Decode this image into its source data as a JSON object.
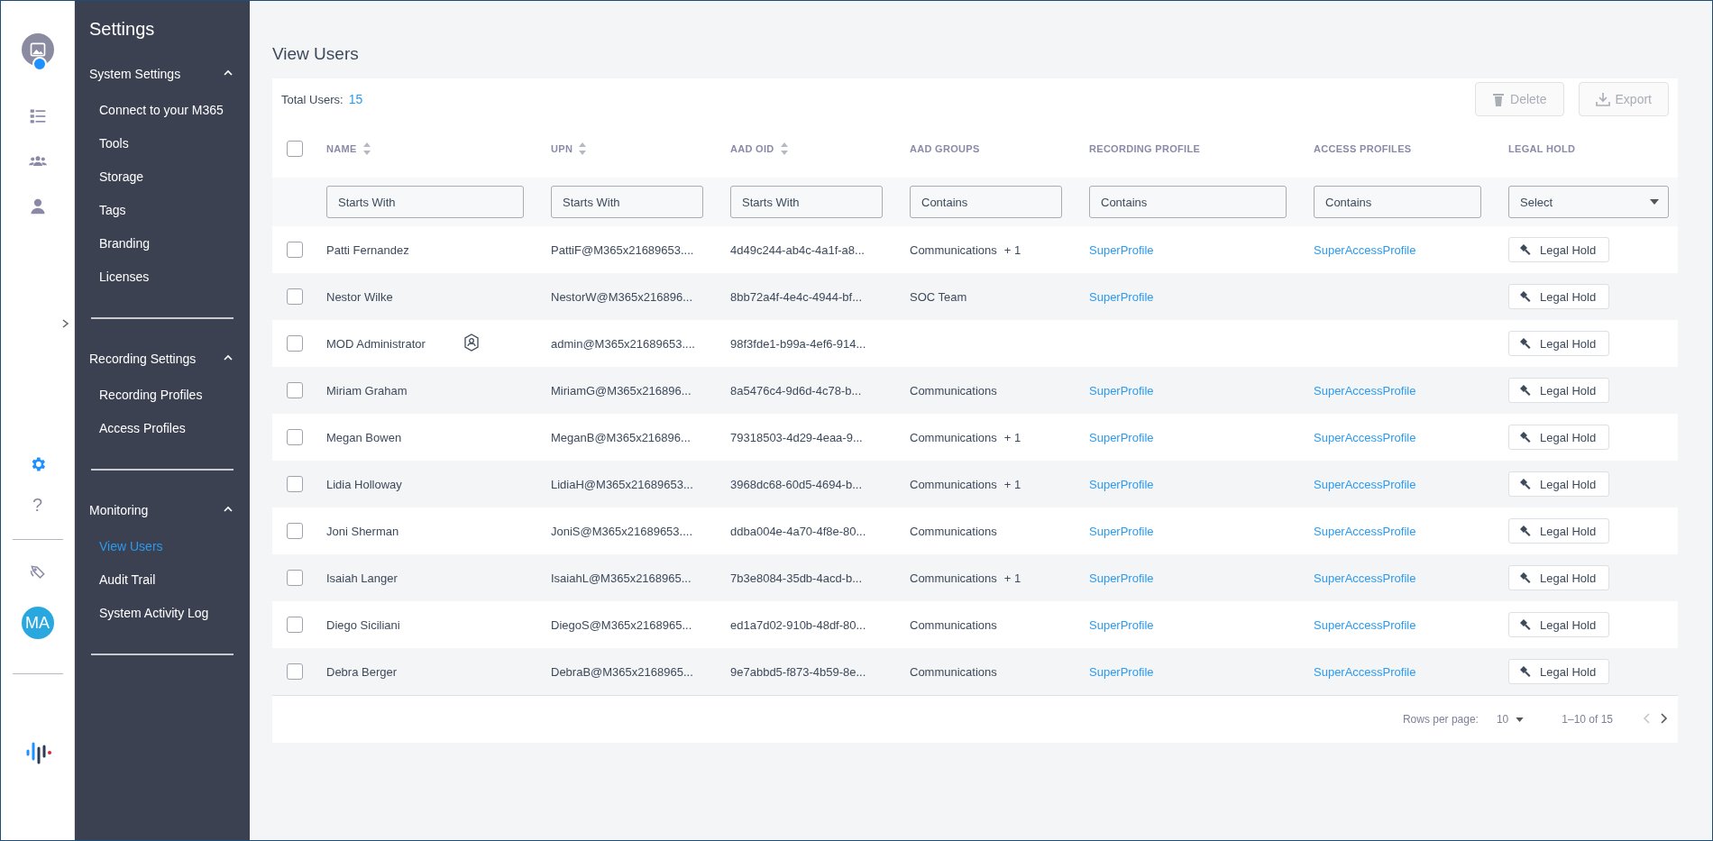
{
  "rail": {
    "help_glyph": "?",
    "user_initials": "MA",
    "settings_selected": true
  },
  "sidebar": {
    "title": "Settings",
    "sections": [
      {
        "title": "System Settings",
        "expanded": true,
        "items": [
          {
            "label": "Connect to your M365",
            "selected": false
          },
          {
            "label": "Tools",
            "selected": false
          },
          {
            "label": "Storage",
            "selected": false
          },
          {
            "label": "Tags",
            "selected": false
          },
          {
            "label": "Branding",
            "selected": false
          },
          {
            "label": "Licenses",
            "selected": false
          }
        ]
      },
      {
        "title": "Recording Settings",
        "expanded": true,
        "items": [
          {
            "label": "Recording Profiles",
            "selected": false
          },
          {
            "label": "Access Profiles",
            "selected": false
          }
        ]
      },
      {
        "title": "Monitoring",
        "expanded": true,
        "items": [
          {
            "label": "View Users",
            "selected": true
          },
          {
            "label": "Audit Trail",
            "selected": false
          },
          {
            "label": "System Activity Log",
            "selected": false
          }
        ]
      }
    ]
  },
  "page": {
    "title": "View Users"
  },
  "summary": {
    "label": "Total Users:",
    "count": "15"
  },
  "actions": [
    {
      "kind": "delete",
      "label": "Delete",
      "disabled": true
    },
    {
      "kind": "export",
      "label": "Export",
      "disabled": true
    }
  ],
  "table": {
    "all_checked": false,
    "columns": [
      {
        "label": "NAME",
        "sortable": true,
        "filter": "Starts With"
      },
      {
        "label": "UPN",
        "sortable": true,
        "filter": "Starts With"
      },
      {
        "label": "AAD OID",
        "sortable": true,
        "filter": "Starts With"
      },
      {
        "label": "AAD GROUPS",
        "sortable": false,
        "filter": "Contains"
      },
      {
        "label": "RECORDING PROFILE",
        "sortable": false,
        "filter": "Contains"
      },
      {
        "label": "ACCESS PROFILES",
        "sortable": false,
        "filter": "Contains"
      },
      {
        "label": "LEGAL HOLD",
        "sortable": false,
        "filter": "Select",
        "kind": "select"
      }
    ],
    "rows": [
      {
        "checked": false,
        "name": "Patti Fernandez",
        "admin": false,
        "upn": "PattiF@M365x21689653....",
        "oid": "4d49c244-ab4c-4a1f-a8...",
        "groups": "Communications",
        "groups_more": "+ 1",
        "recording_profile": "SuperProfile",
        "access_profile": "SuperAccessProfile",
        "action": "Legal Hold"
      },
      {
        "checked": false,
        "name": "Nestor Wilke",
        "admin": false,
        "upn": "NestorW@M365x216896...",
        "oid": "8bb72a4f-4e4c-4944-bf...",
        "groups": "SOC Team",
        "recording_profile": "SuperProfile",
        "action": "Legal Hold"
      },
      {
        "checked": false,
        "name": "MOD Administrator",
        "admin": true,
        "upn": "admin@M365x21689653....",
        "oid": "98f3fde1-b99a-4ef6-914...",
        "action": "Legal Hold"
      },
      {
        "checked": false,
        "name": "Miriam Graham",
        "admin": false,
        "upn": "MiriamG@M365x216896...",
        "oid": "8a5476c4-9d6d-4c78-b...",
        "groups": "Communications",
        "recording_profile": "SuperProfile",
        "access_profile": "SuperAccessProfile",
        "action": "Legal Hold"
      },
      {
        "checked": false,
        "name": "Megan Bowen",
        "admin": false,
        "upn": "MeganB@M365x216896...",
        "oid": "79318503-4d29-4eaa-9...",
        "groups": "Communications",
        "groups_more": "+ 1",
        "recording_profile": "SuperProfile",
        "access_profile": "SuperAccessProfile",
        "action": "Legal Hold"
      },
      {
        "checked": false,
        "name": "Lidia Holloway",
        "admin": false,
        "upn": "LidiaH@M365x21689653...",
        "oid": "3968dc68-60d5-4694-b...",
        "groups": "Communications",
        "groups_more": "+ 1",
        "recording_profile": "SuperProfile",
        "access_profile": "SuperAccessProfile",
        "action": "Legal Hold"
      },
      {
        "checked": false,
        "name": "Joni Sherman",
        "admin": false,
        "upn": "JoniS@M365x21689653....",
        "oid": "ddba004e-4a70-4f8e-80...",
        "groups": "Communications",
        "recording_profile": "SuperProfile",
        "access_profile": "SuperAccessProfile",
        "action": "Legal Hold"
      },
      {
        "checked": false,
        "name": "Isaiah Langer",
        "admin": false,
        "upn": "IsaiahL@M365x2168965...",
        "oid": "7b3e8084-35db-4acd-b...",
        "groups": "Communications",
        "groups_more": "+ 1",
        "recording_profile": "SuperProfile",
        "access_profile": "SuperAccessProfile",
        "action": "Legal Hold"
      },
      {
        "checked": false,
        "name": "Diego Siciliani",
        "admin": false,
        "upn": "DiegoS@M365x2168965...",
        "oid": "ed1a7d02-910b-48df-80...",
        "groups": "Communications",
        "recording_profile": "SuperProfile",
        "access_profile": "SuperAccessProfile",
        "action": "Legal Hold"
      },
      {
        "checked": false,
        "name": "Debra Berger",
        "admin": false,
        "upn": "DebraB@M365x2168965...",
        "oid": "9e7abbd5-f873-4b59-8e...",
        "groups": "Communications",
        "recording_profile": "SuperProfile",
        "access_profile": "SuperAccessProfile",
        "action": "Legal Hold"
      }
    ]
  },
  "pagination": {
    "rows_label": "Rows per page:",
    "rows_value": "10",
    "range": "1–10 of 15",
    "prev_disabled": true
  }
}
